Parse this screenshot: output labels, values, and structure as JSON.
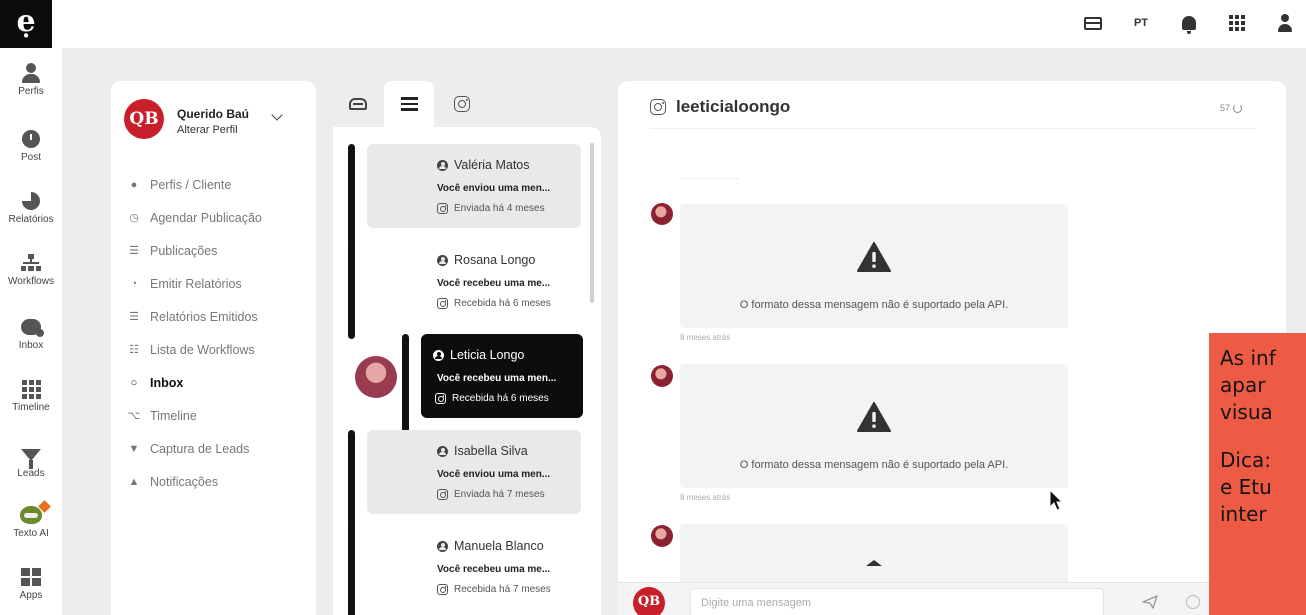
{
  "topbar": {
    "language": "PT",
    "icons": [
      "card-icon",
      "bell-icon",
      "apps-grid-icon",
      "user-icon"
    ]
  },
  "rail": {
    "items": [
      {
        "label": "Perfis",
        "icon": "user-icon"
      },
      {
        "label": "Post",
        "icon": "clock-icon"
      },
      {
        "label": "Relatórios",
        "icon": "pie-chart-icon"
      },
      {
        "label": "Workflows",
        "icon": "sitemap-icon"
      },
      {
        "label": "Inbox",
        "icon": "chat-icon"
      },
      {
        "label": "Timeline",
        "icon": "grid-icon"
      },
      {
        "label": "Leads",
        "icon": "funnel-icon"
      },
      {
        "label": "Texto AI",
        "icon": "robot-icon"
      },
      {
        "label": "Apps",
        "icon": "apps-icon"
      }
    ]
  },
  "profile": {
    "initials": "QB",
    "name": "Querido Baú",
    "action": "Alterar Perfil"
  },
  "menu": {
    "items": [
      {
        "label": "Perfis / Cliente",
        "icon": "user-icon",
        "active": false
      },
      {
        "label": "Agendar Publicação",
        "icon": "clock-icon",
        "active": false
      },
      {
        "label": "Publicações",
        "icon": "list-icon",
        "active": false
      },
      {
        "label": "Emitir Relatórios",
        "icon": "pie-chart-icon",
        "active": false
      },
      {
        "label": "Relatórios Emitidos",
        "icon": "list-icon",
        "active": false
      },
      {
        "label": "Lista de Workflows",
        "icon": "sitemap-icon",
        "active": false
      },
      {
        "label": "Inbox",
        "icon": "chat-icon",
        "active": true
      },
      {
        "label": "Timeline",
        "icon": "rss-icon",
        "active": false
      },
      {
        "label": "Captura de Leads",
        "icon": "funnel-icon",
        "active": false
      },
      {
        "label": "Notificações",
        "icon": "bell-icon",
        "active": false
      }
    ]
  },
  "conversations": [
    {
      "name": "Valéria Matos",
      "snippet": "Você enviou uma men...",
      "status": "Enviada há 4 meses",
      "selected": false,
      "avatar_color": "#c9716a"
    },
    {
      "name": "Rosana Longo",
      "snippet": "Você recebeu uma me...",
      "status": "Recebida há 6 meses",
      "selected": false,
      "avatar_color": "#b99b87"
    },
    {
      "name": "Leticia Longo",
      "snippet": "Você recebeu uma men...",
      "status": "Recebida há 6 meses",
      "selected": true,
      "avatar_color": "#9b3b52"
    },
    {
      "name": "Isabella Silva",
      "snippet": "Você enviou uma men...",
      "status": "Enviada há 7 meses",
      "selected": false,
      "avatar_color": "#4a3a35"
    },
    {
      "name": "Manuela Blanco",
      "snippet": "Você recebeu uma me...",
      "status": "Recebida há 7 meses",
      "selected": false,
      "avatar_color": "#c23a3a"
    }
  ],
  "chat": {
    "handle": "leeticialoongo",
    "count": "57",
    "messages": [
      {
        "text": "O formato dessa mensagem não é suportado pela API.",
        "time": "8 meses atrás"
      },
      {
        "text": "O formato dessa mensagem não é suportado pela API.",
        "time": "8 meses atrás"
      }
    ],
    "input_placeholder": "Digite uma mensagem",
    "input_value": ""
  },
  "callout": {
    "lines": [
      "As inf",
      "apar",
      "visua",
      "",
      "Dica:",
      "e Etu",
      "inter"
    ],
    "color": "#ee5b45"
  },
  "colors": {
    "brand_red": "#c8202a",
    "selected_bg": "#0d0d0d",
    "page_bg": "#ededed"
  }
}
